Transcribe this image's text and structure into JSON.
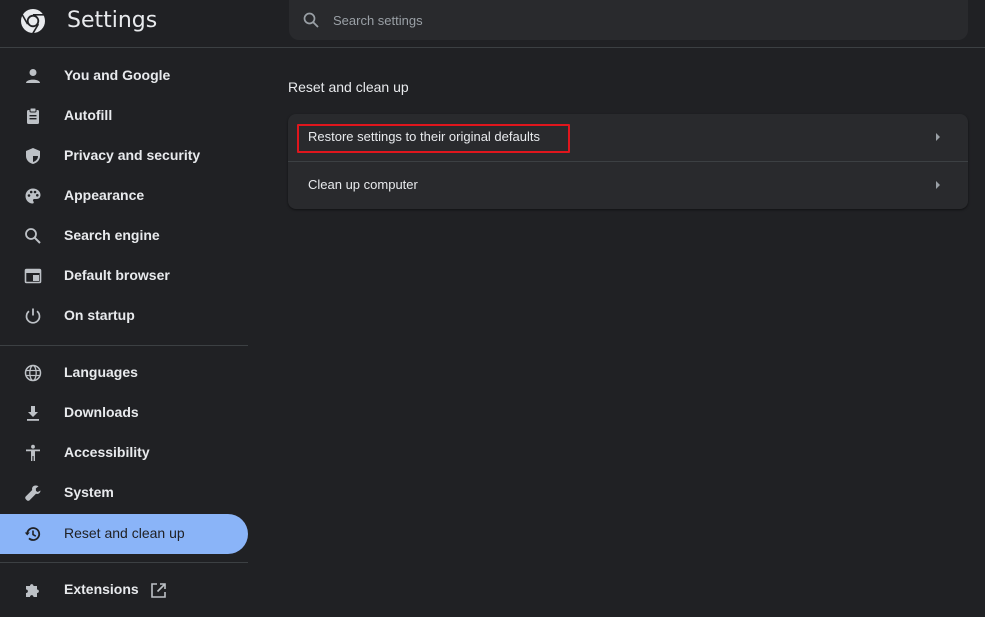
{
  "header": {
    "title": "Settings",
    "logo_icon": "chrome-logo-icon",
    "search": {
      "placeholder": "Search settings",
      "value": ""
    }
  },
  "sidebar": {
    "items": [
      {
        "label": "You and Google",
        "icon": "person-icon"
      },
      {
        "label": "Autofill",
        "icon": "clipboard-icon"
      },
      {
        "label": "Privacy and security",
        "icon": "shield-icon"
      },
      {
        "label": "Appearance",
        "icon": "palette-icon"
      },
      {
        "label": "Search engine",
        "icon": "search-icon"
      },
      {
        "label": "Default browser",
        "icon": "browser-window-icon"
      },
      {
        "label": "On startup",
        "icon": "power-icon"
      },
      {
        "label": "Languages",
        "icon": "globe-icon"
      },
      {
        "label": "Downloads",
        "icon": "download-icon"
      },
      {
        "label": "Accessibility",
        "icon": "accessibility-icon"
      },
      {
        "label": "System",
        "icon": "wrench-icon"
      },
      {
        "label": "Reset and clean up",
        "icon": "history-reset-icon",
        "active": true
      },
      {
        "label": "Extensions",
        "icon": "puzzle-icon",
        "trailing_icon": "open-in-new-icon"
      }
    ]
  },
  "main": {
    "section_title": "Reset and clean up",
    "rows": [
      {
        "label": "Restore settings to their original defaults",
        "highlighted": true
      },
      {
        "label": "Clean up computer"
      }
    ]
  },
  "colors": {
    "background": "#202124",
    "card": "#292a2d",
    "active_nav": "#8ab4f8",
    "highlight_border": "#e0161d",
    "text": "#e8eaed",
    "icon": "#bdc1c6"
  }
}
